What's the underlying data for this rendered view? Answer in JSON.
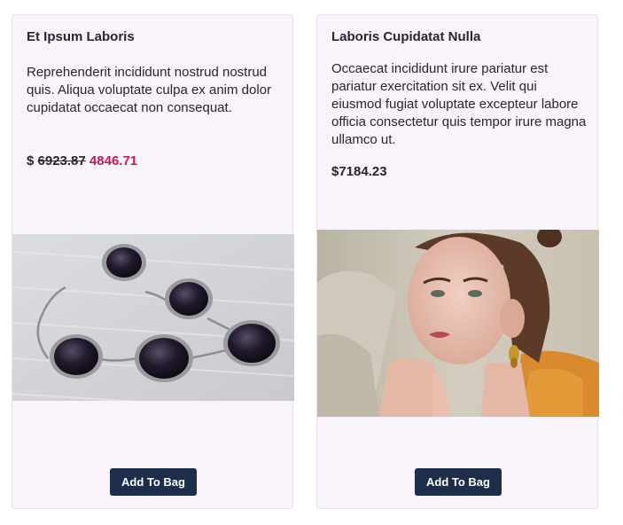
{
  "products": [
    {
      "title": "Et Ipsum Laboris",
      "description": "Reprehenderit incididunt nostrud nostrud quis. Aliqua voluptate culpa ex anim dolor cupidatat occaecat non consequat.",
      "currency": "$",
      "old_price": "6923.87",
      "new_price": "4846.71",
      "image": "black-gem-bracelet",
      "button_label": "Add To Bag"
    },
    {
      "title": "Laboris Cupidatat Nulla",
      "description": "Occaecat incididunt irure pariatur est pariatur exercitation sit ex. Velit qui eiusmod fugiat voluptate excepteur labore officia consectetur quis tempor irure magna ullamco ut.",
      "price": "$7184.23",
      "image": "woman-with-gold-earrings",
      "button_label": "Add To Bag"
    }
  ],
  "colors": {
    "card_background": "#f9f3fb",
    "sale_price": "#c2185b",
    "button": "#1c2e4a"
  }
}
